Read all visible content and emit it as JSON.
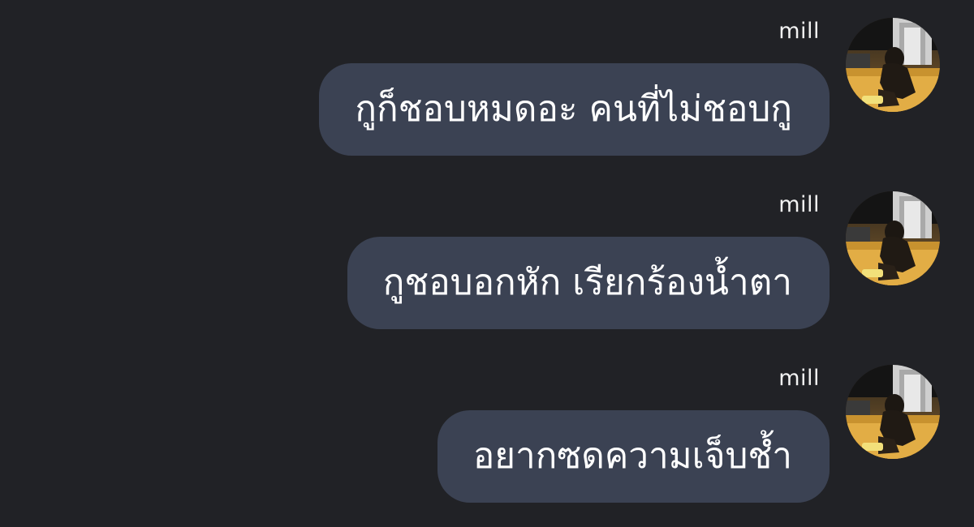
{
  "messages": [
    {
      "sender": "mill",
      "text": "กูก็ชอบหมดอะ คนที่ไม่ชอบกู",
      "avatar_icon": "profile-photo-person-crouching-night-street"
    },
    {
      "sender": "mill",
      "text": "กูชอบอกหัก เรียกร้องน้ำตา",
      "avatar_icon": "profile-photo-person-crouching-night-street"
    },
    {
      "sender": "mill",
      "text": "อยากซดความเจ็บช้ำ",
      "avatar_icon": "profile-photo-person-crouching-night-street"
    }
  ],
  "colors": {
    "background": "#212226",
    "bubble": "#3b4253",
    "text": "#ffffff"
  }
}
